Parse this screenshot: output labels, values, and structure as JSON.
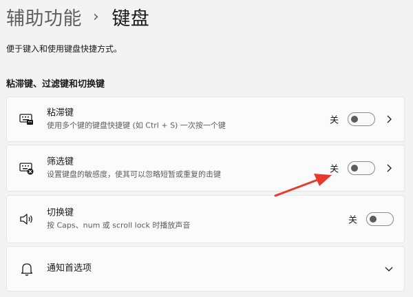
{
  "breadcrumb": {
    "parent": "辅助功能",
    "separator": "›",
    "current": "键盘"
  },
  "description": "便于键入和使用键盘快捷方式。",
  "section_title": "粘滞键、过滤键和切换键",
  "settings": [
    {
      "title": "粘滞键",
      "subtitle": "使用多个键的键盘快捷键 (如 Ctrl + S) 一次按一个键",
      "state_label": "关",
      "toggle_on": false,
      "icon": "sticky-keys-icon",
      "has_chevron": true
    },
    {
      "title": "筛选键",
      "subtitle": "设置键盘的敏感度，使其可以忽略短暂或重复的击键",
      "state_label": "关",
      "toggle_on": false,
      "icon": "filter-keys-icon",
      "has_chevron": true
    },
    {
      "title": "切换键",
      "subtitle": "按 Caps、num 或 scroll lock 时播放声音",
      "state_label": "关",
      "toggle_on": false,
      "icon": "speaker-icon",
      "has_chevron": false
    }
  ],
  "notifications": {
    "title": "通知首选项",
    "icon": "bell-icon"
  },
  "colors": {
    "background": "#f3f3f3",
    "card": "#fbfbfb",
    "annotation_arrow": "#e8392b"
  }
}
